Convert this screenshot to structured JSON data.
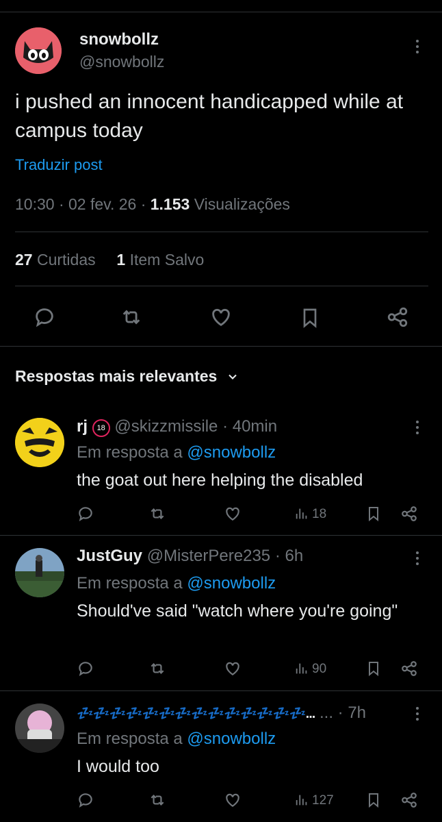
{
  "post": {
    "author_name": "snowbollz",
    "author_handle": "@snowbollz",
    "text": "i pushed an innocent handicapped while at campus today",
    "translate_label": "Traduzir post",
    "time": "10:30 · 02 fev. 26 · ",
    "views_count": "1.153",
    "views_label": " Visualizações",
    "likes_count": "27",
    "likes_label": " Curtidas",
    "saves_count": "1",
    "saves_label": " Item Salvo"
  },
  "sort": {
    "label": "Respostas mais relevantes"
  },
  "replies": [
    {
      "name": "rj",
      "handle": "@skizzmissile",
      "time": "· 40min",
      "reply_prefix": "Em resposta a ",
      "reply_to": "@snowbollz",
      "text": "the goat out here helping the disabled",
      "views": "18",
      "badge": "18"
    },
    {
      "name": "JustGuy",
      "handle": "@MisterPere235",
      "time": "· 6h",
      "reply_prefix": "Em resposta a ",
      "reply_to": "@snowbollz",
      "text": "Should've said \"watch where you're going\"",
      "views": "90"
    },
    {
      "name": "💤💤💤💤💤💤💤💤💤💤💤💤💤💤...",
      "handle": "...",
      "time": "· 7h",
      "reply_prefix": "Em resposta a ",
      "reply_to": "@snowbollz",
      "text": "I would too",
      "views": "127"
    }
  ],
  "icons": [
    "reply-icon",
    "retweet-icon",
    "like-icon",
    "bookmark-icon",
    "share-icon",
    "views-icon",
    "more-icon",
    "chevron-down-icon"
  ],
  "colors": {
    "background": "#000000",
    "text": "#e7e9ea",
    "muted": "#71767b",
    "link": "#1d9bf0",
    "divider": "#2f3336"
  }
}
